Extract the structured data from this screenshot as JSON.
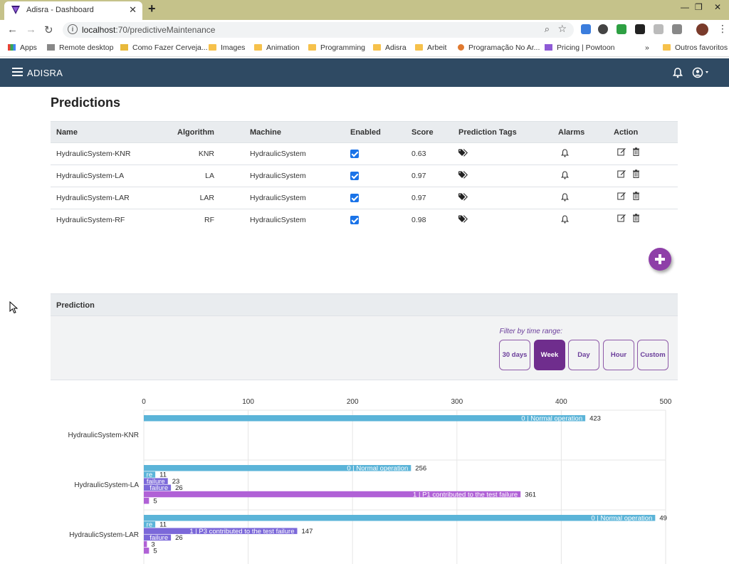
{
  "browser": {
    "tab_title": "Adisra - Dashboard",
    "url_host": "localhost",
    "url_path": ":70/predictiveMaintenance",
    "bookmarks": [
      "Apps",
      "Remote desktop",
      "Como Fazer Cerveja...",
      "Images",
      "Animation",
      "Programming",
      "Adisra",
      "Arbeit",
      "Programação No Ar...",
      "Pricing | Powtoon",
      "»",
      "Outros favoritos"
    ]
  },
  "navbar": {
    "brand": "ADISRA",
    "icons": [
      "hamburger-icon",
      "bell-icon",
      "user-icon"
    ]
  },
  "page_title": "Predictions",
  "table": {
    "headers": [
      "Name",
      "Algorithm",
      "Machine",
      "Enabled",
      "Score",
      "Prediction Tags",
      "Alarms",
      "Action"
    ],
    "rows": [
      {
        "name": "HydraulicSystem-KNR",
        "algorithm": "KNR",
        "machine": "HydraulicSystem",
        "enabled": true,
        "score": "0.63"
      },
      {
        "name": "HydraulicSystem-LA",
        "algorithm": "LA",
        "machine": "HydraulicSystem",
        "enabled": true,
        "score": "0.97"
      },
      {
        "name": "HydraulicSystem-LAR",
        "algorithm": "LAR",
        "machine": "HydraulicSystem",
        "enabled": true,
        "score": "0.97"
      },
      {
        "name": "HydraulicSystem-RF",
        "algorithm": "RF",
        "machine": "HydraulicSystem",
        "enabled": true,
        "score": "0.98"
      }
    ]
  },
  "prediction_panel": {
    "title": "Prediction",
    "filter_label": "Filter by time range:",
    "ranges": [
      "30 days",
      "Week",
      "Day",
      "Hour",
      "Custom"
    ],
    "active_range": "Week"
  },
  "colors": {
    "navbar": "#2f4a63",
    "accent": "#6f2d8d",
    "bar_blue": "#5bb4d8",
    "bar_indigo": "#7b68d9",
    "bar_violet": "#b061d6"
  },
  "chart_data": {
    "type": "bar",
    "orientation": "horizontal",
    "x_ticks": [
      0,
      100,
      200,
      300,
      400,
      500
    ],
    "xlim": [
      0,
      500
    ],
    "groups": [
      {
        "label": "HydraulicSystem-KNR",
        "bars": [
          {
            "value": 423,
            "value_label": "423",
            "text": "0 | Normal operation",
            "color": "#5bb4d8"
          }
        ]
      },
      {
        "label": "HydraulicSystem-LA",
        "bars": [
          {
            "value": 256,
            "value_label": "256",
            "text": "0 | Normal operation",
            "color": "#5bb4d8"
          },
          {
            "value": 11,
            "value_label": "11",
            "text": "re",
            "color": "#5bb4d8"
          },
          {
            "value": 23,
            "value_label": "23",
            "text": "failure",
            "color": "#7b68d9"
          },
          {
            "value": 26,
            "value_label": "26",
            "text": "failure",
            "color": "#7b68d9"
          },
          {
            "value": 361,
            "value_label": "361",
            "text": "1 | P1 contributed to the test failure",
            "color": "#b061d6"
          },
          {
            "value": 5,
            "value_label": "5",
            "text": "",
            "color": "#b061d6"
          }
        ]
      },
      {
        "label": "HydraulicSystem-LAR",
        "bars": [
          {
            "value": 490,
            "value_label": "49",
            "text": "0 | Normal operation",
            "color": "#5bb4d8"
          },
          {
            "value": 11,
            "value_label": "11",
            "text": "re",
            "color": "#5bb4d8"
          },
          {
            "value": 147,
            "value_label": "147",
            "text": "1 | P3 contributed to the test failure",
            "color": "#7b68d9"
          },
          {
            "value": 26,
            "value_label": "26",
            "text": "failure",
            "color": "#7b68d9"
          },
          {
            "value": 3,
            "value_label": "3",
            "text": "",
            "color": "#b061d6"
          },
          {
            "value": 5,
            "value_label": "5",
            "text": "",
            "color": "#b061d6"
          }
        ]
      }
    ]
  }
}
